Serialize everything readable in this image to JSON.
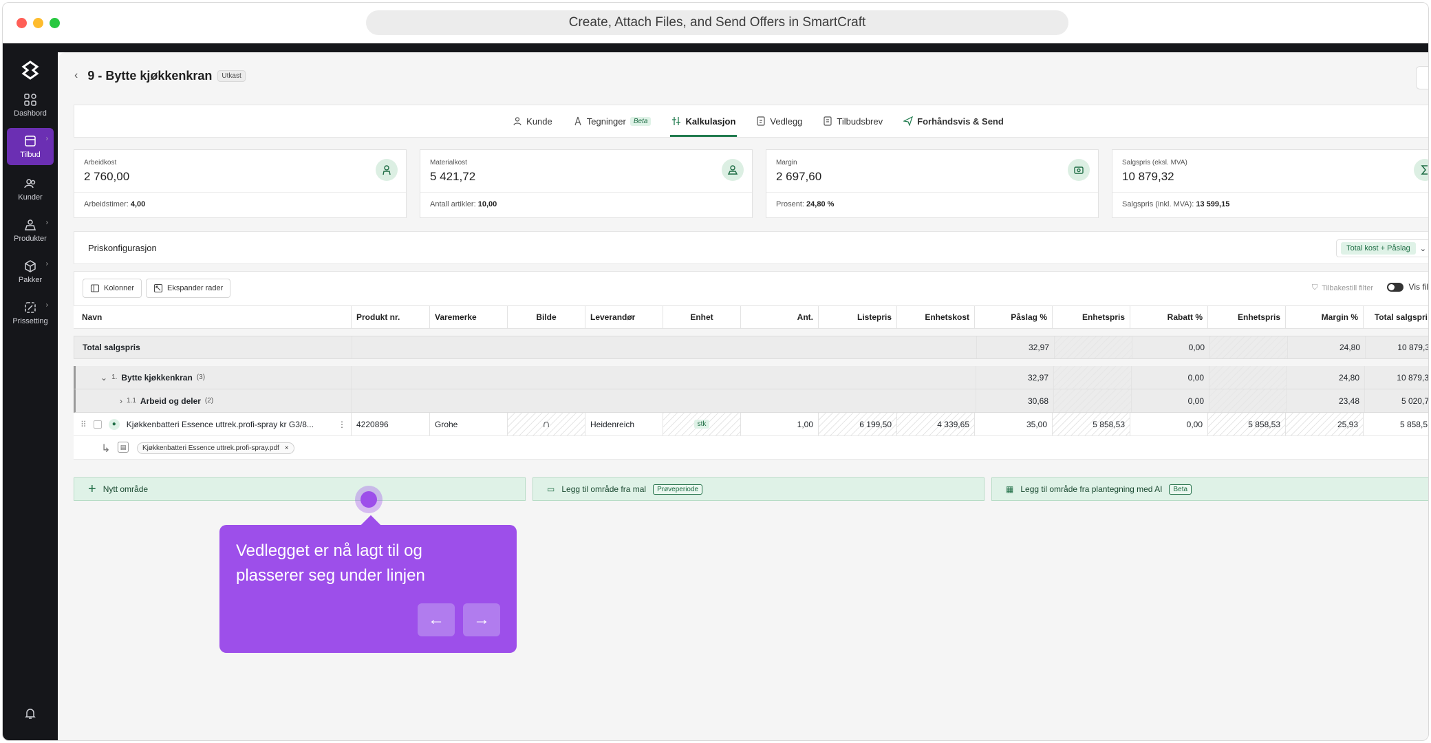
{
  "window": {
    "title": "Create, Attach Files, and Send Offers in SmartCraft"
  },
  "sidebar": {
    "items": [
      {
        "label": "Dashbord",
        "icon": "dashboard-icon"
      },
      {
        "label": "Tilbud",
        "icon": "calculator-icon",
        "active": true
      },
      {
        "label": "Kunder",
        "icon": "users-icon"
      },
      {
        "label": "Produkter",
        "icon": "product-icon"
      },
      {
        "label": "Pakker",
        "icon": "package-icon"
      },
      {
        "label": "Prissetting",
        "icon": "pricing-icon"
      }
    ]
  },
  "header": {
    "title": "9 - Bytte kjøkkenkran",
    "status": "Utkast"
  },
  "tabs": [
    {
      "label": "Kunde"
    },
    {
      "label": "Tegninger",
      "tag": "Beta"
    },
    {
      "label": "Kalkulasjon",
      "active": true
    },
    {
      "label": "Vedlegg"
    },
    {
      "label": "Tilbudsbrev"
    },
    {
      "label": "Forhåndsvis & Send"
    }
  ],
  "cards": [
    {
      "label": "Arbeidkost",
      "value": "2 760,00",
      "sub_label": "Arbeidstimer:",
      "sub_value": "4,00"
    },
    {
      "label": "Materialkost",
      "value": "5 421,72",
      "sub_label": "Antall artikler:",
      "sub_value": "10,00"
    },
    {
      "label": "Margin",
      "value": "2 697,60",
      "sub_label": "Prosent:",
      "sub_value": "24,80 %"
    },
    {
      "label": "Salgspris (eksl. MVA)",
      "value": "10 879,32",
      "sub_label": "Salgspris (inkl. MVA):",
      "sub_value": "13 599,15"
    }
  ],
  "price_config": {
    "title": "Priskonfigurasjon",
    "mode": "Total kost + Påslag"
  },
  "toolbar": {
    "columns": "Kolonner",
    "expand": "Ekspander rader",
    "reset_filter": "Tilbakestill filter",
    "show_filter": "Vis filter"
  },
  "table": {
    "headers": [
      "Navn",
      "Produkt nr.",
      "Varemerke",
      "Bilde",
      "Leverandør",
      "Enhet",
      "Ant.",
      "Listepris",
      "Enhetskost",
      "Påslag %",
      "Enhetspris",
      "Rabatt %",
      "Enhetspris",
      "Margin %",
      "Total salgspri"
    ],
    "total": {
      "name": "Total salgspris",
      "paslag": "32,97",
      "rabatt": "0,00",
      "margin": "24,80",
      "total": "10 879,3"
    },
    "group1": {
      "num": "1.",
      "name": "Bytte kjøkkenkran",
      "count": "(3)",
      "paslag": "32,97",
      "rabatt": "0,00",
      "margin": "24,80",
      "total": "10 879,3"
    },
    "group2": {
      "num": "1.1",
      "name": "Arbeid og deler",
      "count": "(2)",
      "paslag": "30,68",
      "rabatt": "0,00",
      "margin": "23,48",
      "total": "5 020,7"
    },
    "item": {
      "name": "Kjøkkenbatteri Essence uttrek.profi-spray kr G3/8...",
      "prodnr": "4220896",
      "brand": "Grohe",
      "supplier": "Heidenreich",
      "unit": "stk",
      "qty": "1,00",
      "listprice": "6 199,50",
      "unitcost": "4 339,65",
      "paslag": "35,00",
      "unitprice": "5 858,53",
      "rabatt": "0,00",
      "unitprice2": "5 858,53",
      "margin": "25,93",
      "total": "5 858,5"
    },
    "attachment": {
      "filename": "Kjøkkenbatteri Essence uttrek.profi-spray.pdf"
    }
  },
  "areas": [
    {
      "label": "Nytt område"
    },
    {
      "label": "Legg til område fra mal",
      "badge": "Prøveperiode"
    },
    {
      "label": "Legg til område fra plantegning med AI",
      "badge": "Beta"
    }
  ],
  "tooltip": {
    "text": "Vedlegget er nå lagt til og plasserer seg under linjen"
  },
  "colors": {
    "accent": "#9d4fea",
    "brand_green": "#1f7a4d",
    "sidebar": "#15161a",
    "active_nav": "#6b2fb3"
  }
}
